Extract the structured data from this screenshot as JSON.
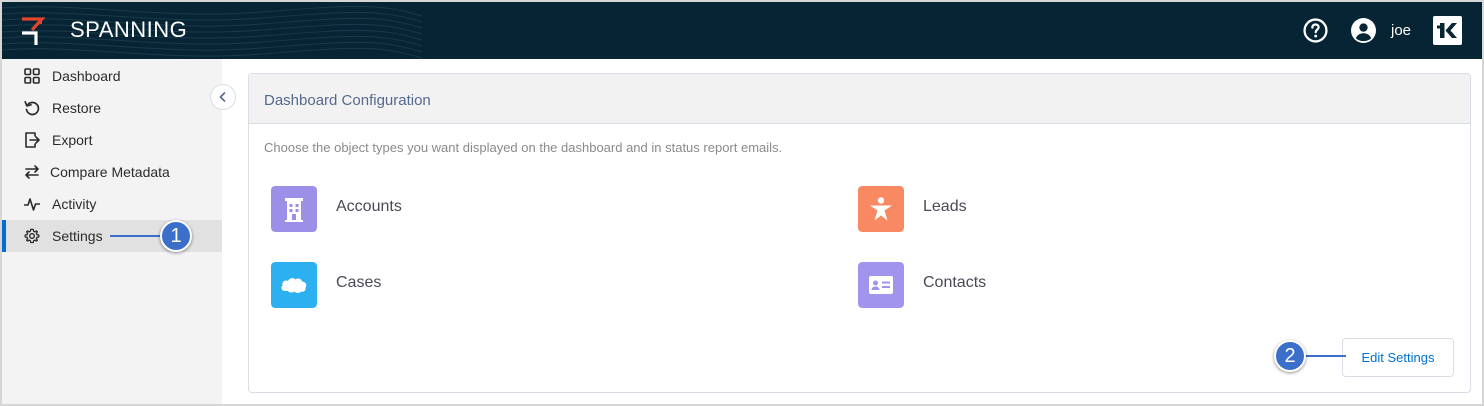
{
  "header": {
    "brand": "SPANNING",
    "user_name": "joe",
    "icons": [
      "spanning-logo-icon",
      "help-icon",
      "user-avatar-icon",
      "kaseya-logo-icon"
    ]
  },
  "sidebar": {
    "items": [
      {
        "label": "Dashboard",
        "icon": "dashboard-grid-icon"
      },
      {
        "label": "Restore",
        "icon": "restore-icon"
      },
      {
        "label": "Export",
        "icon": "export-icon"
      },
      {
        "label": "Compare Metadata",
        "icon": "compare-arrows-icon"
      },
      {
        "label": "Activity",
        "icon": "activity-pulse-icon"
      },
      {
        "label": "Settings",
        "icon": "gear-icon",
        "active": true
      }
    ],
    "collapse_icon": "chevron-left-icon"
  },
  "main": {
    "card_title": "Dashboard Configuration",
    "description": "Choose the object types you want displayed on the dashboard and in status report emails.",
    "objects": [
      {
        "label": "Accounts",
        "icon": "accounts-building-icon",
        "color": "#9c8fe8"
      },
      {
        "label": "Leads",
        "icon": "leads-star-person-icon",
        "color": "#f88962"
      },
      {
        "label": "Cases",
        "icon": "cases-cloud-icon",
        "color": "#2db0ef"
      },
      {
        "label": "Contacts",
        "icon": "contacts-card-icon",
        "color": "#a094ed"
      }
    ],
    "edit_button": "Edit Settings"
  },
  "callouts": [
    "1",
    "2"
  ],
  "colors": {
    "header_bg": "#062433",
    "accent": "#0070d2",
    "callout": "#3b6fc9"
  }
}
